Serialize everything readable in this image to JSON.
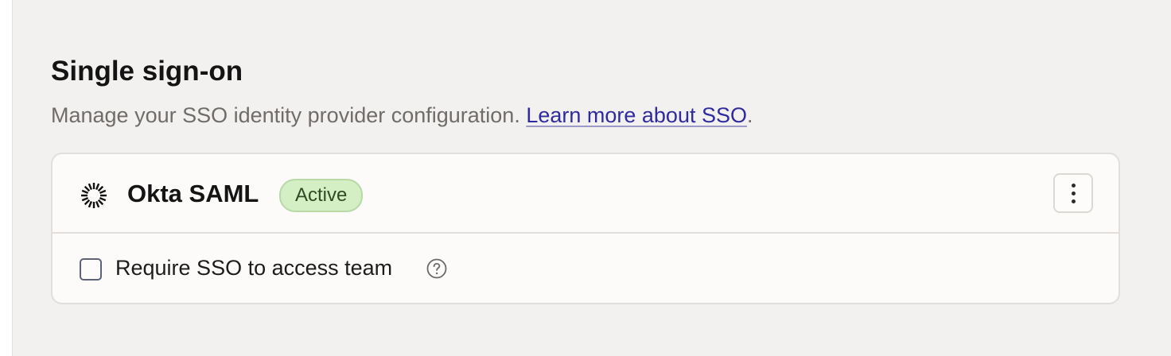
{
  "section": {
    "title": "Single sign-on",
    "description": "Manage your SSO identity provider configuration. ",
    "learn_more_link": "Learn more about SSO",
    "description_end": "."
  },
  "provider": {
    "icon": "okta-logo-icon",
    "name": "Okta SAML",
    "status": "Active",
    "menu_icon": "more-vertical-icon"
  },
  "option": {
    "label": "Require SSO to access team",
    "checked": false,
    "help_icon": "question-circle-icon"
  },
  "colors": {
    "background": "#f3f1ef",
    "card": "#fcfbfa",
    "link": "#2f2a9e",
    "badge_background": "#d3efc3",
    "badge_border": "#b6d9a5"
  }
}
